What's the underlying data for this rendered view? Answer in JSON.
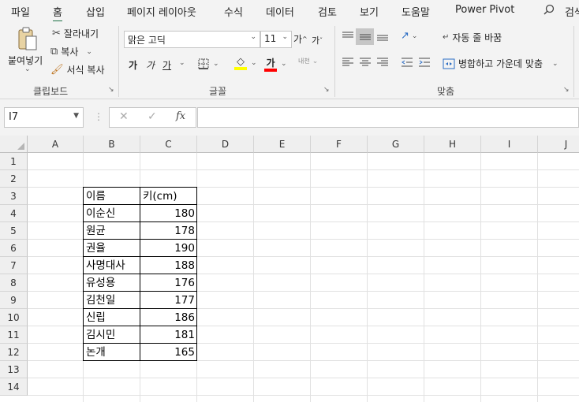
{
  "tabs": [
    "파일",
    "홈",
    "삽입",
    "페이지 레이아웃",
    "수식",
    "데이터",
    "검토",
    "보기",
    "도움말",
    "Power Pivot",
    "검색"
  ],
  "ribbon": {
    "clipboard": {
      "paste_label": "붙여넣기",
      "cut_label": "잘라내기",
      "copy_label": "복사",
      "format_painter_label": "서식 복사",
      "group_label": "클립보드"
    },
    "font": {
      "font_name": "맑은 고딕",
      "font_size": "11",
      "grow_label": "가",
      "shrink_label": "가",
      "bold_label": "가",
      "italic_label": "가",
      "underline_label": "가",
      "font_color_label": "가",
      "phonetic_label": "내천",
      "group_label": "글꼴",
      "fill_color": "#ffff00",
      "font_color": "#ff0000"
    },
    "alignment": {
      "wrap_text_label": "자동 줄 바꿈",
      "merge_center_label": "병합하고 가운데 맞춤",
      "group_label": "맞춤"
    }
  },
  "formula_bar": {
    "name_box": "I7",
    "cancel_icon": "✕",
    "enter_icon": "✓",
    "fx_label": "fx",
    "formula": ""
  },
  "sheet": {
    "columns": [
      "A",
      "B",
      "C",
      "D",
      "E",
      "F",
      "G",
      "H",
      "I",
      "J"
    ],
    "rows": [
      "1",
      "2",
      "3",
      "4",
      "5",
      "6",
      "7",
      "8",
      "9",
      "10",
      "11",
      "12",
      "13",
      "14"
    ],
    "table": {
      "header": [
        "이름",
        "키(cm)"
      ],
      "rows": [
        [
          "이순신",
          "180"
        ],
        [
          "원균",
          "178"
        ],
        [
          "권율",
          "190"
        ],
        [
          "사명대사",
          "188"
        ],
        [
          "유성용",
          "176"
        ],
        [
          "김천일",
          "177"
        ],
        [
          "신립",
          "186"
        ],
        [
          "김시민",
          "181"
        ],
        [
          "논개",
          "165"
        ]
      ]
    }
  }
}
